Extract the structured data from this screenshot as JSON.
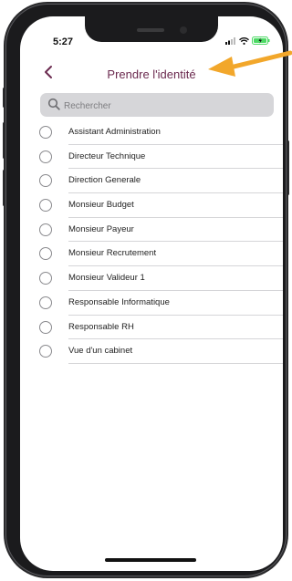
{
  "status": {
    "time": "5:27"
  },
  "nav": {
    "back_icon": "chevron-left-icon",
    "title": "Prendre l'identité"
  },
  "search": {
    "placeholder": "Rechercher"
  },
  "items": [
    {
      "label": "Assistant Administration"
    },
    {
      "label": "Directeur Technique"
    },
    {
      "label": "Direction Generale"
    },
    {
      "label": "Monsieur Budget"
    },
    {
      "label": "Monsieur Payeur"
    },
    {
      "label": "Monsieur Recrutement"
    },
    {
      "label": "Monsieur Valideur 1"
    },
    {
      "label": "Responsable Informatique"
    },
    {
      "label": "Responsable RH"
    },
    {
      "label": "Vue d'un cabinet"
    }
  ],
  "colors": {
    "accent": "#6b2a4f",
    "annotation_arrow": "#f2a72b",
    "battery": "#4cd964"
  }
}
